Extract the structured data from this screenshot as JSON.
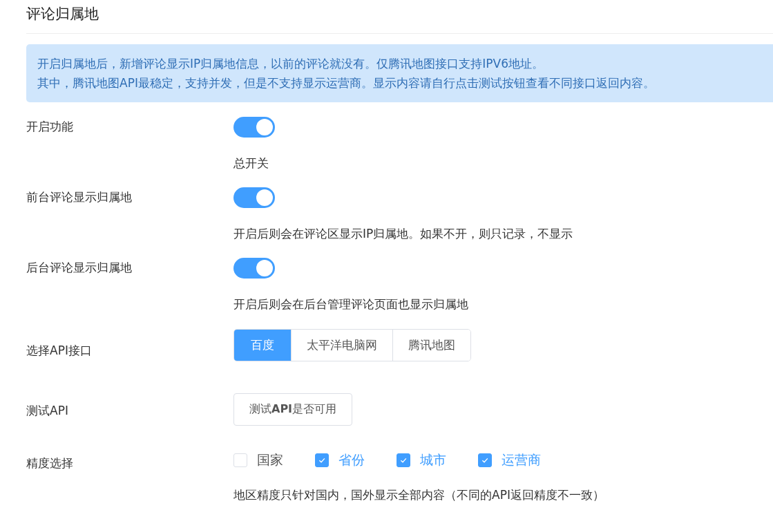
{
  "title": "评论归属地",
  "notice": [
    "开启归属地后，新增评论显示IP归属地信息，以前的评论就没有。仅腾讯地图接口支持IPV6地址。",
    "其中，腾讯地图API最稳定，支持并发，但是不支持显示运营商。显示内容请自行点击测试按钮查看不同接口返回内容。"
  ],
  "settings": [
    {
      "kind": "switch",
      "label": "开启功能",
      "on": true,
      "description": "总开关"
    },
    {
      "kind": "switch",
      "label": "前台评论显示归属地",
      "on": true,
      "description": "开启后则会在评论区显示IP归属地。如果不开，则只记录，不显示"
    },
    {
      "kind": "switch",
      "label": "后台评论显示归属地",
      "on": true,
      "description": "开启后则会在后台管理评论页面也显示归属地"
    },
    {
      "kind": "radio",
      "label": "选择API接口",
      "options": [
        {
          "label": "百度",
          "selected": true
        },
        {
          "label": "太平洋电脑网",
          "selected": false
        },
        {
          "label": "腾讯地图",
          "selected": false
        }
      ]
    },
    {
      "kind": "button",
      "label": "测试API",
      "button": "测试**API**是否可用"
    },
    {
      "kind": "checkbox",
      "label": "精度选择",
      "options": [
        {
          "label": "国家",
          "checked": false
        },
        {
          "label": "省份",
          "checked": true
        },
        {
          "label": "城市",
          "checked": true
        },
        {
          "label": "运营商",
          "checked": true
        }
      ],
      "description": "地区精度只针对国内，国外显示全部内容（不同的API返回精度不一致）"
    }
  ]
}
